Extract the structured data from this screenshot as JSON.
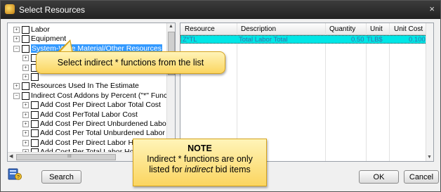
{
  "window": {
    "title": "Select Resources",
    "close_glyph": "×"
  },
  "tree": {
    "items": [
      {
        "label": "Labor",
        "expander": "+",
        "indent": 0,
        "selected": false
      },
      {
        "label": "Equipment",
        "expander": "+",
        "indent": 0,
        "selected": false
      },
      {
        "label": "System-Wide Material/Other Resources",
        "expander": "−",
        "indent": 0,
        "selected": true
      },
      {
        "label": "",
        "expander": "+",
        "indent": 1,
        "selected": false
      },
      {
        "label": "",
        "expander": "+",
        "indent": 1,
        "selected": false
      },
      {
        "label": "",
        "expander": "+",
        "indent": 1,
        "selected": false
      },
      {
        "label": "Resources Used In The Estimate",
        "expander": "+",
        "indent": 0,
        "selected": false
      },
      {
        "label": "Indirect Cost Addons by Percent (\"*\" Functions)",
        "expander": "−",
        "indent": 0,
        "selected": false
      },
      {
        "label": "Add Cost Per Direct Labor Total Cost",
        "expander": "+",
        "indent": 1,
        "selected": false
      },
      {
        "label": "Add Cost PerTotal Labor Cost",
        "expander": "+",
        "indent": 1,
        "selected": false
      },
      {
        "label": "Add Cost Per Direct Unburdened Labor Cost",
        "expander": "+",
        "indent": 1,
        "selected": false
      },
      {
        "label": "Add Cost Per Total Unburdened Labor Cost",
        "expander": "+",
        "indent": 1,
        "selected": false
      },
      {
        "label": "Add Cost Per Direct Labor Hours",
        "expander": "+",
        "indent": 1,
        "selected": false
      },
      {
        "label": "Add Cost Per Total Labor Hours",
        "expander": "+",
        "indent": 1,
        "selected": false
      }
    ],
    "scroll_grip": "III"
  },
  "grid": {
    "columns": [
      "Resource",
      "Description",
      "Quantity",
      "Unit",
      "Unit Cost"
    ],
    "rows": [
      {
        "resource": "Z*TL",
        "description": "Total Labor Total",
        "quantity": "0.50",
        "unit": "TLB$",
        "unit_cost": "0.1000"
      }
    ]
  },
  "callout": {
    "text": "Select indirect * functions from the list"
  },
  "note": {
    "title": "NOTE",
    "line1": "Indirect * functions are only",
    "line2_prefix": "listed for ",
    "line2_em": "indirect",
    "line2_suffix": " bid items"
  },
  "buttons": {
    "search": "Search",
    "ok": "OK",
    "cancel": "Cancel"
  },
  "icons": {
    "help": "help-icon",
    "app": "app-icon"
  },
  "colors": {
    "selected_row": "#00e6e6",
    "tree_selection": "#3399ff",
    "callout_fill": "#fbd560"
  }
}
